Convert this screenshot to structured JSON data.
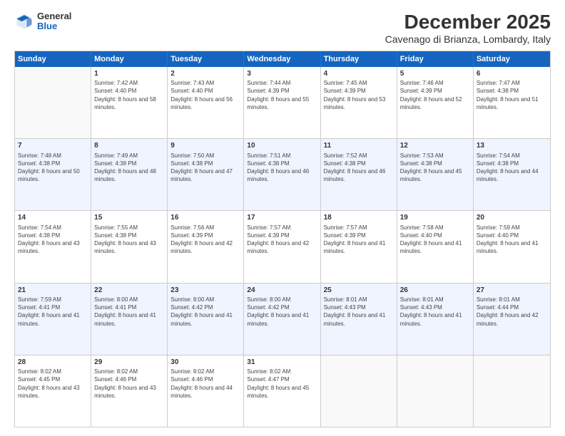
{
  "logo": {
    "general": "General",
    "blue": "Blue"
  },
  "title": "December 2025",
  "subtitle": "Cavenago di Brianza, Lombardy, Italy",
  "header": {
    "days": [
      "Sunday",
      "Monday",
      "Tuesday",
      "Wednesday",
      "Thursday",
      "Friday",
      "Saturday"
    ]
  },
  "rows": [
    [
      {
        "day": "",
        "sunrise": "",
        "sunset": "",
        "daylight": "",
        "alt": false,
        "empty": true
      },
      {
        "day": "1",
        "sunrise": "Sunrise: 7:42 AM",
        "sunset": "Sunset: 4:40 PM",
        "daylight": "Daylight: 8 hours and 58 minutes.",
        "alt": false,
        "empty": false
      },
      {
        "day": "2",
        "sunrise": "Sunrise: 7:43 AM",
        "sunset": "Sunset: 4:40 PM",
        "daylight": "Daylight: 8 hours and 56 minutes.",
        "alt": false,
        "empty": false
      },
      {
        "day": "3",
        "sunrise": "Sunrise: 7:44 AM",
        "sunset": "Sunset: 4:39 PM",
        "daylight": "Daylight: 8 hours and 55 minutes.",
        "alt": false,
        "empty": false
      },
      {
        "day": "4",
        "sunrise": "Sunrise: 7:45 AM",
        "sunset": "Sunset: 4:39 PM",
        "daylight": "Daylight: 8 hours and 53 minutes.",
        "alt": false,
        "empty": false
      },
      {
        "day": "5",
        "sunrise": "Sunrise: 7:46 AM",
        "sunset": "Sunset: 4:39 PM",
        "daylight": "Daylight: 8 hours and 52 minutes.",
        "alt": false,
        "empty": false
      },
      {
        "day": "6",
        "sunrise": "Sunrise: 7:47 AM",
        "sunset": "Sunset: 4:38 PM",
        "daylight": "Daylight: 8 hours and 51 minutes.",
        "alt": false,
        "empty": false
      }
    ],
    [
      {
        "day": "7",
        "sunrise": "Sunrise: 7:48 AM",
        "sunset": "Sunset: 4:38 PM",
        "daylight": "Daylight: 8 hours and 50 minutes.",
        "alt": true,
        "empty": false
      },
      {
        "day": "8",
        "sunrise": "Sunrise: 7:49 AM",
        "sunset": "Sunset: 4:38 PM",
        "daylight": "Daylight: 8 hours and 48 minutes.",
        "alt": true,
        "empty": false
      },
      {
        "day": "9",
        "sunrise": "Sunrise: 7:50 AM",
        "sunset": "Sunset: 4:38 PM",
        "daylight": "Daylight: 8 hours and 47 minutes.",
        "alt": true,
        "empty": false
      },
      {
        "day": "10",
        "sunrise": "Sunrise: 7:51 AM",
        "sunset": "Sunset: 4:38 PM",
        "daylight": "Daylight: 8 hours and 46 minutes.",
        "alt": true,
        "empty": false
      },
      {
        "day": "11",
        "sunrise": "Sunrise: 7:52 AM",
        "sunset": "Sunset: 4:38 PM",
        "daylight": "Daylight: 8 hours and 46 minutes.",
        "alt": true,
        "empty": false
      },
      {
        "day": "12",
        "sunrise": "Sunrise: 7:53 AM",
        "sunset": "Sunset: 4:38 PM",
        "daylight": "Daylight: 8 hours and 45 minutes.",
        "alt": true,
        "empty": false
      },
      {
        "day": "13",
        "sunrise": "Sunrise: 7:54 AM",
        "sunset": "Sunset: 4:38 PM",
        "daylight": "Daylight: 8 hours and 44 minutes.",
        "alt": true,
        "empty": false
      }
    ],
    [
      {
        "day": "14",
        "sunrise": "Sunrise: 7:54 AM",
        "sunset": "Sunset: 4:38 PM",
        "daylight": "Daylight: 8 hours and 43 minutes.",
        "alt": false,
        "empty": false
      },
      {
        "day": "15",
        "sunrise": "Sunrise: 7:55 AM",
        "sunset": "Sunset: 4:38 PM",
        "daylight": "Daylight: 8 hours and 43 minutes.",
        "alt": false,
        "empty": false
      },
      {
        "day": "16",
        "sunrise": "Sunrise: 7:56 AM",
        "sunset": "Sunset: 4:39 PM",
        "daylight": "Daylight: 8 hours and 42 minutes.",
        "alt": false,
        "empty": false
      },
      {
        "day": "17",
        "sunrise": "Sunrise: 7:57 AM",
        "sunset": "Sunset: 4:39 PM",
        "daylight": "Daylight: 8 hours and 42 minutes.",
        "alt": false,
        "empty": false
      },
      {
        "day": "18",
        "sunrise": "Sunrise: 7:57 AM",
        "sunset": "Sunset: 4:39 PM",
        "daylight": "Daylight: 8 hours and 41 minutes.",
        "alt": false,
        "empty": false
      },
      {
        "day": "19",
        "sunrise": "Sunrise: 7:58 AM",
        "sunset": "Sunset: 4:40 PM",
        "daylight": "Daylight: 8 hours and 41 minutes.",
        "alt": false,
        "empty": false
      },
      {
        "day": "20",
        "sunrise": "Sunrise: 7:59 AM",
        "sunset": "Sunset: 4:40 PM",
        "daylight": "Daylight: 8 hours and 41 minutes.",
        "alt": false,
        "empty": false
      }
    ],
    [
      {
        "day": "21",
        "sunrise": "Sunrise: 7:59 AM",
        "sunset": "Sunset: 4:41 PM",
        "daylight": "Daylight: 8 hours and 41 minutes.",
        "alt": true,
        "empty": false
      },
      {
        "day": "22",
        "sunrise": "Sunrise: 8:00 AM",
        "sunset": "Sunset: 4:41 PM",
        "daylight": "Daylight: 8 hours and 41 minutes.",
        "alt": true,
        "empty": false
      },
      {
        "day": "23",
        "sunrise": "Sunrise: 8:00 AM",
        "sunset": "Sunset: 4:42 PM",
        "daylight": "Daylight: 8 hours and 41 minutes.",
        "alt": true,
        "empty": false
      },
      {
        "day": "24",
        "sunrise": "Sunrise: 8:00 AM",
        "sunset": "Sunset: 4:42 PM",
        "daylight": "Daylight: 8 hours and 41 minutes.",
        "alt": true,
        "empty": false
      },
      {
        "day": "25",
        "sunrise": "Sunrise: 8:01 AM",
        "sunset": "Sunset: 4:43 PM",
        "daylight": "Daylight: 8 hours and 41 minutes.",
        "alt": true,
        "empty": false
      },
      {
        "day": "26",
        "sunrise": "Sunrise: 8:01 AM",
        "sunset": "Sunset: 4:43 PM",
        "daylight": "Daylight: 8 hours and 41 minutes.",
        "alt": true,
        "empty": false
      },
      {
        "day": "27",
        "sunrise": "Sunrise: 8:01 AM",
        "sunset": "Sunset: 4:44 PM",
        "daylight": "Daylight: 8 hours and 42 minutes.",
        "alt": true,
        "empty": false
      }
    ],
    [
      {
        "day": "28",
        "sunrise": "Sunrise: 8:02 AM",
        "sunset": "Sunset: 4:45 PM",
        "daylight": "Daylight: 8 hours and 43 minutes.",
        "alt": false,
        "empty": false
      },
      {
        "day": "29",
        "sunrise": "Sunrise: 8:02 AM",
        "sunset": "Sunset: 4:46 PM",
        "daylight": "Daylight: 8 hours and 43 minutes.",
        "alt": false,
        "empty": false
      },
      {
        "day": "30",
        "sunrise": "Sunrise: 8:02 AM",
        "sunset": "Sunset: 4:46 PM",
        "daylight": "Daylight: 8 hours and 44 minutes.",
        "alt": false,
        "empty": false
      },
      {
        "day": "31",
        "sunrise": "Sunrise: 8:02 AM",
        "sunset": "Sunset: 4:47 PM",
        "daylight": "Daylight: 8 hours and 45 minutes.",
        "alt": false,
        "empty": false
      },
      {
        "day": "",
        "sunrise": "",
        "sunset": "",
        "daylight": "",
        "alt": false,
        "empty": true
      },
      {
        "day": "",
        "sunrise": "",
        "sunset": "",
        "daylight": "",
        "alt": false,
        "empty": true
      },
      {
        "day": "",
        "sunrise": "",
        "sunset": "",
        "daylight": "",
        "alt": false,
        "empty": true
      }
    ]
  ]
}
